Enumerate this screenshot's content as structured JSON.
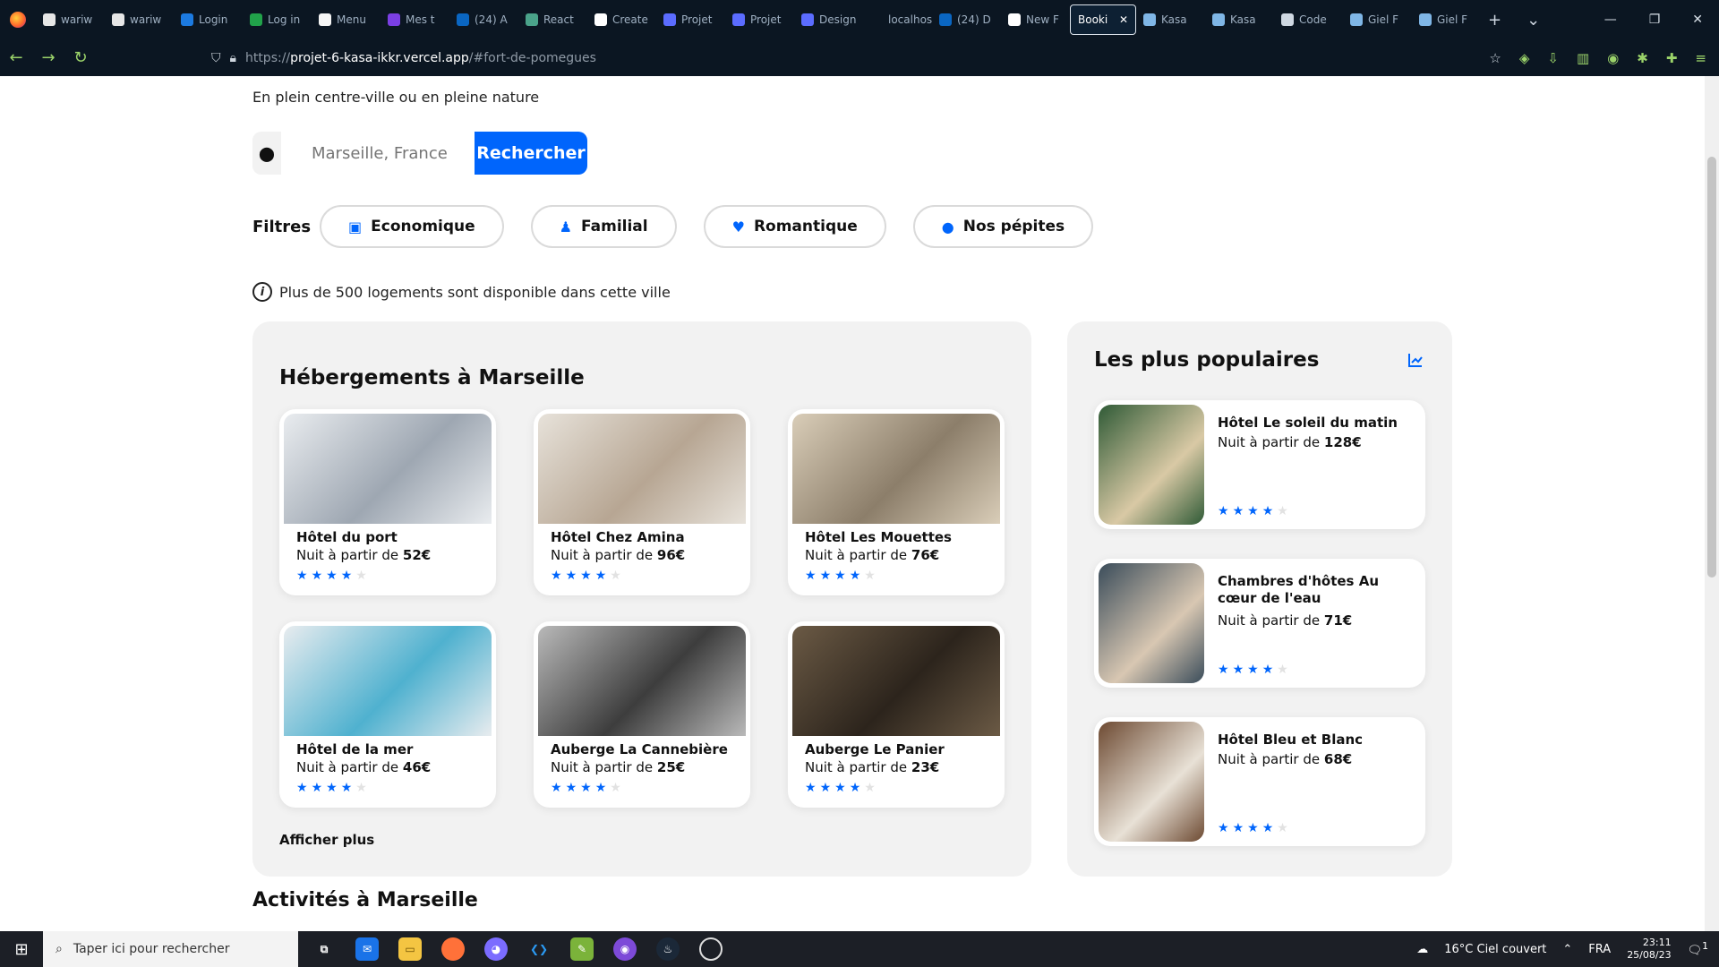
{
  "browser": {
    "tabs": [
      {
        "label": "wariw",
        "fav": "#e6e6e6"
      },
      {
        "label": "wariw",
        "fav": "#e6e6e6"
      },
      {
        "label": "Login",
        "fav": "#1c7ae0"
      },
      {
        "label": "Log in",
        "fav": "#21a24a"
      },
      {
        "label": "Menu",
        "fav": "#f5f5f5"
      },
      {
        "label": "Mes t",
        "fav": "#7b3fe4"
      },
      {
        "label": "(24) A",
        "fav": "#0a66c2"
      },
      {
        "label": "React",
        "fav": "#4aa38a"
      },
      {
        "label": "Create",
        "fav": "#ffffff"
      },
      {
        "label": "Projet",
        "fav": "#5b6cff"
      },
      {
        "label": "Projet",
        "fav": "#5b6cff"
      },
      {
        "label": "Design",
        "fav": "#5b6cff"
      },
      {
        "label": "localhost",
        "fav": "#0b1622"
      },
      {
        "label": "(24) D",
        "fav": "#0a66c2"
      },
      {
        "label": "New F",
        "fav": "#ffffff"
      }
    ],
    "active_tab": "Booki",
    "tabs_after": [
      {
        "label": "Kasa",
        "fav": "#7fb6e6"
      },
      {
        "label": "Kasa",
        "fav": "#7fb6e6"
      },
      {
        "label": "Code",
        "fav": "#cfd8e2"
      },
      {
        "label": "Giel F",
        "fav": "#7fb6e6"
      },
      {
        "label": "Giel F",
        "fav": "#7fb6e6"
      }
    ],
    "url_scheme": "https://",
    "url_host": "projet-6-kasa-ikkr.vercel.app",
    "url_path": "/#fort-de-pomegues"
  },
  "page": {
    "subtitle": "En plein centre-ville ou en pleine nature",
    "search": {
      "placeholder": "Marseille, France",
      "button": "Rechercher"
    },
    "filters_label": "Filtres",
    "filters": [
      {
        "icon": "money-icon",
        "glyph": "▣",
        "label": "Economique"
      },
      {
        "icon": "person-icon",
        "glyph": "♟",
        "label": "Familial"
      },
      {
        "icon": "heart-icon",
        "glyph": "♥",
        "label": "Romantique"
      },
      {
        "icon": "flame-icon",
        "glyph": "●",
        "label": "Nos pépites"
      }
    ],
    "info_text": "Plus de 500 logements sont disponible dans cette ville",
    "accommodations_title": "Hébergements à Marseille",
    "accommodations": [
      {
        "name": "Hôtel du port",
        "price_prefix": "Nuit à partir de ",
        "price": "52€",
        "rating": 4,
        "img": [
          "#9ea7b2",
          "#e9ecef"
        ]
      },
      {
        "name": "Hôtel Chez Amina",
        "price_prefix": "Nuit à partir de ",
        "price": "96€",
        "rating": 4,
        "img": [
          "#b7a693",
          "#e7e2da"
        ]
      },
      {
        "name": "Hôtel Les Mouettes",
        "price_prefix": "Nuit à partir de ",
        "price": "76€",
        "rating": 4,
        "img": [
          "#8c7e6a",
          "#d9cdb8"
        ]
      },
      {
        "name": "Hôtel de la mer",
        "price_prefix": "Nuit à partir de ",
        "price": "46€",
        "rating": 4,
        "img": [
          "#4fb1cf",
          "#e8ecef"
        ]
      },
      {
        "name": "Auberge La Cannebière",
        "price_prefix": "Nuit à partir de ",
        "price": "25€",
        "rating": 4,
        "img": [
          "#3d3d3d",
          "#b9b9b9"
        ]
      },
      {
        "name": "Auberge Le Panier",
        "price_prefix": "Nuit à partir de ",
        "price": "23€",
        "rating": 4,
        "img": [
          "#2c241c",
          "#6b5a45"
        ]
      }
    ],
    "show_more": "Afficher plus",
    "popular_title": "Les plus populaires",
    "popular": [
      {
        "name": "Hôtel Le soleil du matin",
        "price_prefix": "Nuit à partir de ",
        "price": "128€",
        "rating": 4,
        "img": [
          "#2f5a36",
          "#d9c9a5"
        ]
      },
      {
        "name": "Chambres d'hôtes Au cœur de l'eau",
        "price_prefix": "Nuit à partir de ",
        "price": "71€",
        "rating": 4,
        "img": [
          "#3a4c5a",
          "#d8c7b2"
        ]
      },
      {
        "name": "Hôtel Bleu et Blanc",
        "price_prefix": "Nuit à partir de ",
        "price": "68€",
        "rating": 4,
        "img": [
          "#6d4a32",
          "#e8e1d6"
        ]
      }
    ],
    "activities_title": "Activités à Marseille"
  },
  "taskbar": {
    "search_placeholder": "Taper ici pour rechercher",
    "weather": "16°C  Ciel couvert",
    "lang": "FRA",
    "time": "23:11",
    "date": "25/08/23",
    "notifications": "1"
  },
  "colors": {
    "accent": "#0065fc",
    "panel": "#f2f2f2"
  }
}
